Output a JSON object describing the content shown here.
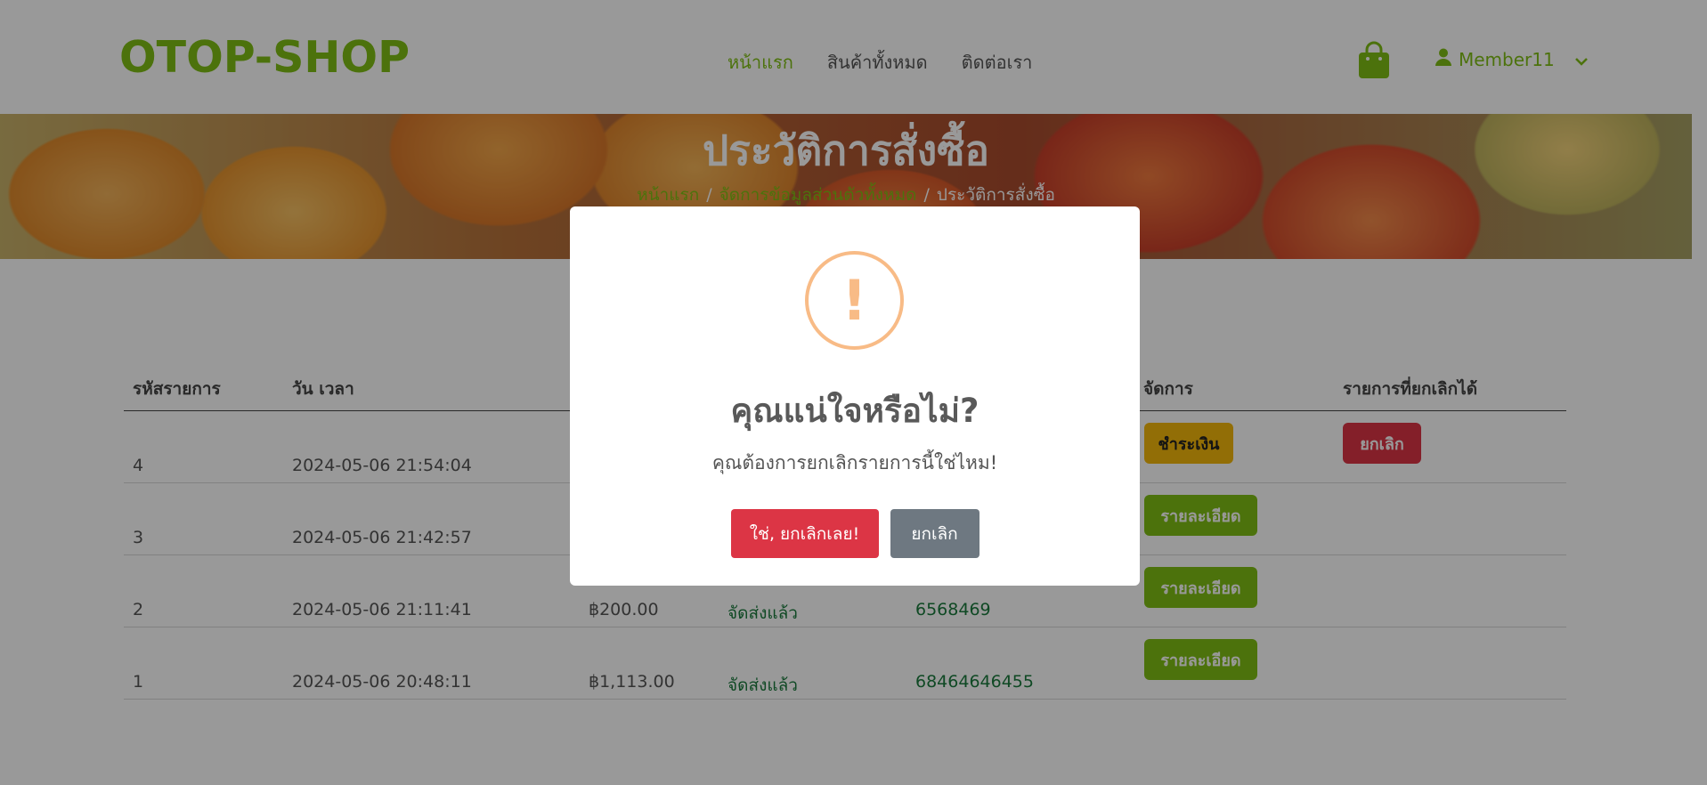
{
  "brand": {
    "logo": "OTOP-SHOP",
    "accent": "#7fbf14"
  },
  "nav": {
    "items": [
      "หน้าแรก",
      "สินค้าทั้งหมด",
      "ติดต่อเรา"
    ],
    "active_index": 0
  },
  "header": {
    "cart_icon": "shopping-bag-icon",
    "user_icon": "user-icon",
    "user_name": "Member11",
    "dropdown_icon": "chevron-down-icon"
  },
  "hero": {
    "title": "ประวัติการสั่งซื้อ",
    "breadcrumb": {
      "home": "หน้าแรก",
      "manage": "จัดการข้อมูลส่วนตัวทั้งหมด",
      "current": "ประวัติการสั่งซื้อ",
      "separator": "/"
    }
  },
  "table": {
    "headers": {
      "order_id": "รหัสรายการ",
      "datetime": "วัน เวลา",
      "manage": "จัดการ",
      "cancellable": "รายการที่ยกเลิกได้"
    },
    "rows": [
      {
        "id": "4",
        "datetime": "2024-05-06 21:54:04",
        "total": "",
        "status": "",
        "tracking": "",
        "action": "ชำระเงิน",
        "cancel": "ยกเลิก"
      },
      {
        "id": "3",
        "datetime": "2024-05-06 21:42:57",
        "total": "",
        "status": "",
        "tracking": "",
        "action": "รายละเอียด",
        "cancel": ""
      },
      {
        "id": "2",
        "datetime": "2024-05-06 21:11:41",
        "total": "฿200.00",
        "status": "จัดส่งแล้ว",
        "tracking": "6568469",
        "action": "รายละเอียด",
        "cancel": ""
      },
      {
        "id": "1",
        "datetime": "2024-05-06 20:48:11",
        "total": "฿1,113.00",
        "status": "จัดส่งแล้ว",
        "tracking": "68464646455",
        "action": "รายละเอียด",
        "cancel": ""
      }
    ]
  },
  "dialog": {
    "icon": "warning-icon",
    "icon_mark": "!",
    "title": "คุณแน่ใจหรือไม่?",
    "text": "คุณต้องการยกเลิกรายการนี้ใช่ไหม!",
    "confirm_label": "ใช่, ยกเลิกเลย!",
    "cancel_label": "ยกเลิก"
  }
}
